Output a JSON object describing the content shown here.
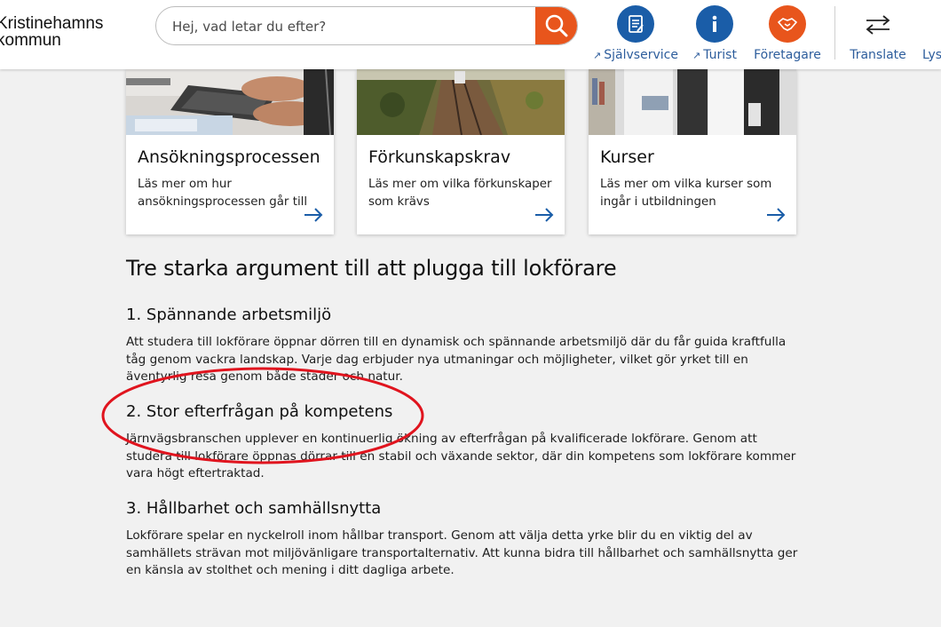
{
  "header": {
    "logo_line1": "Kristinehamns",
    "logo_line2": "kommun",
    "search": {
      "placeholder": "Hej, vad letar du efter?",
      "icon": "search-icon"
    },
    "services": [
      {
        "label": "Självservice",
        "icon": "document-list-icon",
        "color": "#1a5da8",
        "external": true
      },
      {
        "label": "Turist",
        "icon": "info-icon",
        "color": "#1a5da8",
        "external": true
      },
      {
        "label": "Företagare",
        "icon": "handshake-icon",
        "color": "#e8551c",
        "external": false
      }
    ],
    "translate": {
      "label": "Translate",
      "icon": "swap-arrows-icon"
    },
    "lyssna": {
      "label": "Lys"
    },
    "link_color": "#2d5d9c"
  },
  "cards": [
    {
      "title": "Ansökningsprocessen",
      "text": "Läs mer om hur ansökningsprocessen går till",
      "image": "keyboard-photo"
    },
    {
      "title": "Förkunskapskrav",
      "text": "Läs mer om vilka förkunskaper som krävs",
      "image": "train-aerial-photo"
    },
    {
      "title": "Kurser",
      "text": "Läs mer om vilka kurser som ingår i utbildningen",
      "image": "students-photo"
    }
  ],
  "article": {
    "heading": "Tre starka argument till att plugga till lokförare",
    "sections": [
      {
        "title": "1. Spännande arbetsmiljö",
        "body": "Att studera till lokförare öppnar dörren till en dynamisk och spännande arbetsmiljö där du får guida kraftfulla tåg genom vackra landskap. Varje dag erbjuder nya utmaningar och möjligheter, vilket gör yrket till en äventyrlig resa genom både städer och natur."
      },
      {
        "title": "2. Stor efterfrågan på kompetens",
        "body": "Järnvägsbranschen upplever en kontinuerlig ökning av efterfrågan på kvalificerade lokförare. Genom att studera till lokförare öppnas dörrar till en stabil och växande sektor, där din kompetens som lokförare kommer vara högt eftertraktad."
      },
      {
        "title": "3. Hållbarhet och samhällsnytta",
        "body": "Lokförare spelar en nyckelroll inom hållbar transport. Genom att välja detta yrke blir du en viktig del av samhällets strävan mot miljövänligare transportalternativ. Att kunna bidra till hållbarhet och samhällsnytta ger en känsla av stolthet och mening i ditt dagliga arbete."
      }
    ]
  },
  "annotation": {
    "shape": "ellipse",
    "color": "#e0141e",
    "target": "2. Stor efterfrågan på kompetens"
  }
}
